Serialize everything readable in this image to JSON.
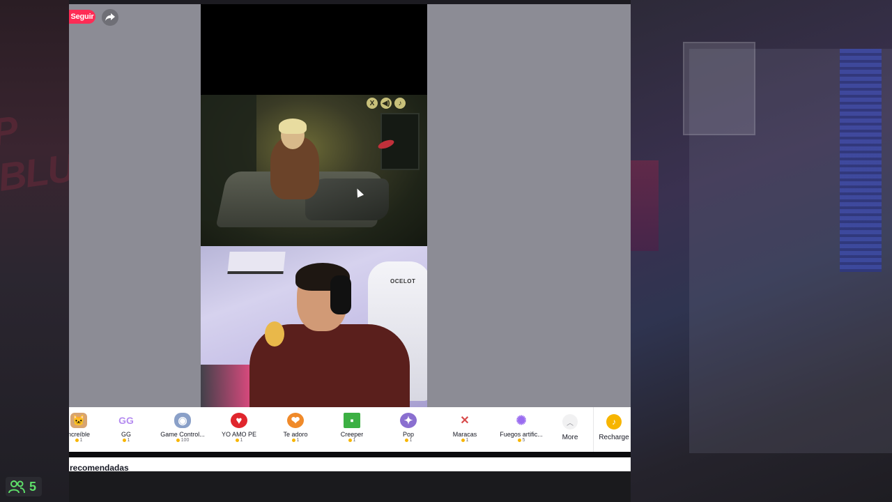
{
  "header": {
    "follow_label": "Seguir",
    "share_icon": "share-icon"
  },
  "game": {
    "icons": [
      "X",
      "◀)",
      "♪"
    ]
  },
  "webcam": {
    "chair_brand": "OCELOT"
  },
  "gifts": [
    {
      "name": "Increíble",
      "display_name": "ncreíble",
      "price": "1",
      "icon": "cat-icon",
      "color": "#d8a470"
    },
    {
      "name": "GG",
      "display_name": "GG",
      "price": "1",
      "icon": "gg-icon",
      "color": "#b58cf0"
    },
    {
      "name": "Game Controller",
      "display_name": "Game Control...",
      "price": "100",
      "icon": "controller-icon",
      "color": "#8aa0c8"
    },
    {
      "name": "YO AMO PE",
      "display_name": "YO AMO PE",
      "price": "1",
      "icon": "heart-ball-icon",
      "color": "#e0262d"
    },
    {
      "name": "Te adoro",
      "display_name": "Te adoro",
      "price": "1",
      "icon": "hug-icon",
      "color": "#f08a2a"
    },
    {
      "name": "Creeper",
      "display_name": "Creeper",
      "price": "1",
      "icon": "creeper-icon",
      "color": "#3cb043"
    },
    {
      "name": "Pop",
      "display_name": "Pop",
      "price": "1",
      "icon": "pop-icon",
      "color": "#8a6fd0"
    },
    {
      "name": "Maracas",
      "display_name": "Maracas",
      "price": "1",
      "icon": "maracas-icon",
      "color": "#d84a4a"
    },
    {
      "name": "Fuegos artificiales",
      "display_name": "Fuegos artific...",
      "price": "5",
      "icon": "fireworks-icon",
      "color": "#9a6cf0"
    }
  ],
  "more_label": "More",
  "recharge_label": "Recharge",
  "section_title": "recomendadas",
  "viewers": {
    "count": "5",
    "icon": "people-icon"
  },
  "background": {
    "neon_text": "P BLUE"
  }
}
